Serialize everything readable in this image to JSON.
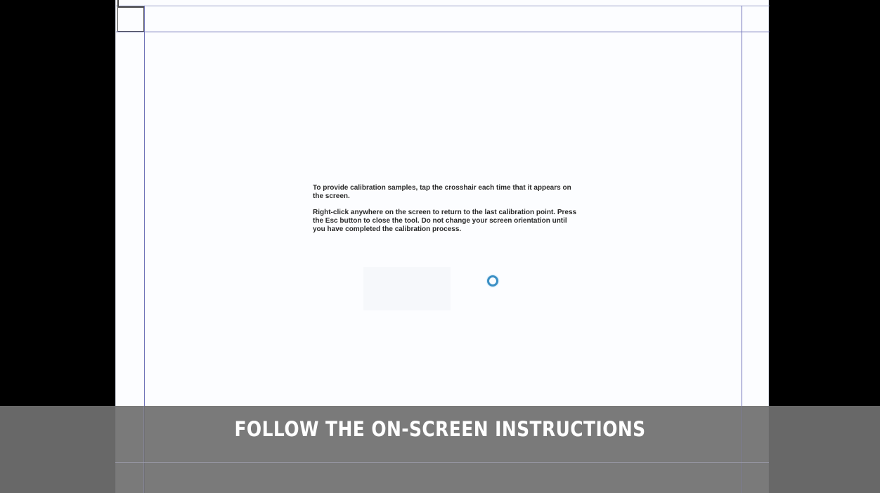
{
  "calibration": {
    "instruction_1": "To provide calibration samples, tap the crosshair each time that it appears on the screen.",
    "instruction_2": "Right-click anywhere on the screen to return to the last calibration point. Press the Esc button to close the tool. Do not change your screen orientation until you have completed the calibration process.",
    "target_icon": "calibration-target-ring-icon",
    "guide_line_color": "#6f73b8",
    "target_color": "#3a8fc4"
  },
  "caption": {
    "text": "FOLLOW THE ON-SCREEN INSTRUCTIONS"
  },
  "colors": {
    "background": "#000000",
    "screen": "#fcfdff",
    "banner": "#707070"
  }
}
